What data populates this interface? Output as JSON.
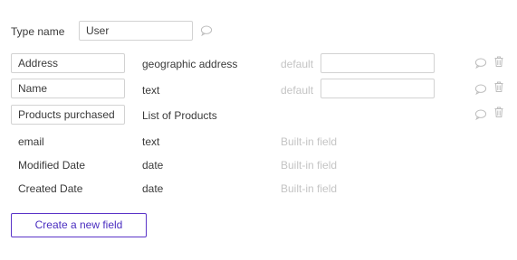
{
  "type_name": {
    "label": "Type name",
    "value": "User"
  },
  "fields": [
    {
      "name": "Address",
      "type": "geographic address",
      "default_label": "default",
      "default_value": "",
      "editable": true
    },
    {
      "name": "Name",
      "type": "text",
      "default_label": "default",
      "default_value": "",
      "editable": true
    },
    {
      "name": "Products purchased",
      "type": "List of Products",
      "editable": true
    },
    {
      "name": "email",
      "type": "text",
      "status": "Built-in field",
      "editable": false
    },
    {
      "name": "Modified Date",
      "type": "date",
      "status": "Built-in field",
      "editable": false
    },
    {
      "name": "Created Date",
      "type": "date",
      "status": "Built-in field",
      "editable": false
    }
  ],
  "create_button": {
    "label": "Create a new field"
  },
  "icons": {
    "comment": "comment-icon",
    "delete": "trash-icon"
  },
  "colors": {
    "accent": "#4a2ec0",
    "muted_text": "#c4c4c4",
    "border": "#d2d2d2",
    "icon": "#bdbdbd"
  }
}
